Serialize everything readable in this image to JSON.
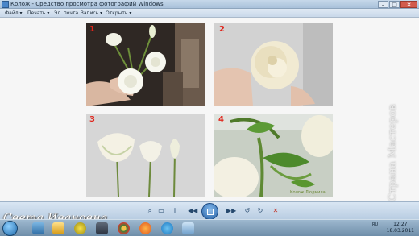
{
  "window": {
    "title": "Колож - Средство просмотра фотографий Windows",
    "minimize": "–",
    "maximize": "□",
    "close": "✕"
  },
  "menu": {
    "items": [
      "Файл ▾",
      "Печать ▾",
      "Эл. почта",
      "Запись ▾",
      "Открыть ▾"
    ]
  },
  "photos": [
    {
      "number": "1"
    },
    {
      "number": "2"
    },
    {
      "number": "3"
    },
    {
      "number": "4"
    }
  ],
  "photo4_caption": "Колож Людмила",
  "controls": {
    "info": "i",
    "rotate_left": "↺",
    "rotate_right": "↻",
    "delete": "✕"
  },
  "watermark": {
    "name": "Света Ивановна",
    "site": "Страна Мастеров"
  },
  "taskbar": {
    "language": "RU",
    "time": "12:27",
    "date": "18.03.2011"
  },
  "colors": {
    "accent": "#2a63a6",
    "number_red": "#e0241b"
  }
}
